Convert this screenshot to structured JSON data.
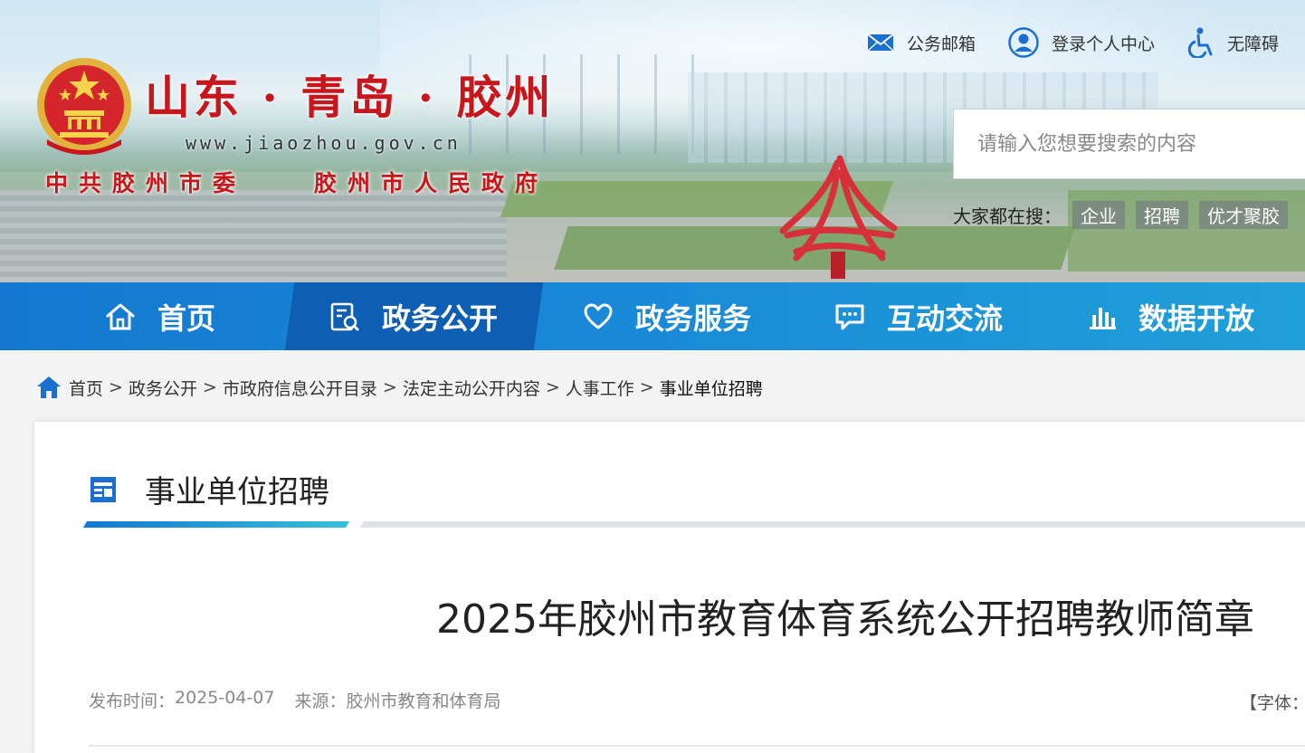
{
  "header": {
    "title_main": "山东 · 青岛 · 胶州",
    "url": "www.jiaozhou.gov.cn",
    "org_party": "中共胶州市委",
    "org_gov": "胶州市人民政府",
    "top_links": [
      {
        "label": "公务邮箱",
        "icon": "mail-icon"
      },
      {
        "label": "登录个人中心",
        "icon": "user-icon"
      },
      {
        "label": "无障碍",
        "icon": "accessibility-icon"
      }
    ],
    "search": {
      "placeholder": "请输入您想要搜索的内容"
    },
    "hot": {
      "label": "大家都在搜：",
      "tags": [
        "企业",
        "招聘",
        "优才聚胶"
      ]
    }
  },
  "nav": {
    "items": [
      {
        "label": "首页",
        "icon": "home-icon"
      },
      {
        "label": "政务公开",
        "icon": "document-search-icon",
        "active": true
      },
      {
        "label": "政务服务",
        "icon": "heart-icon"
      },
      {
        "label": "互动交流",
        "icon": "chat-icon"
      },
      {
        "label": "数据开放",
        "icon": "bar-chart-icon"
      }
    ]
  },
  "breadcrumb": {
    "items": [
      "首页",
      "政务公开",
      "市政府信息公开目录",
      "法定主动公开内容",
      "人事工作",
      "事业单位招聘"
    ],
    "separator": ">"
  },
  "section": {
    "title": "事业单位招聘"
  },
  "article": {
    "title": "2025年胶州市教育体育系统公开招聘教师简章",
    "date_label": "发布时间：",
    "date": "2025-04-07",
    "source_label": "来源：",
    "source": "胶州市教育和体育局",
    "font_label": "【字体："
  },
  "colors": {
    "brand_red": "#c8161d",
    "nav_blue": "#1478d0",
    "nav_active": "#0e5fb3"
  }
}
